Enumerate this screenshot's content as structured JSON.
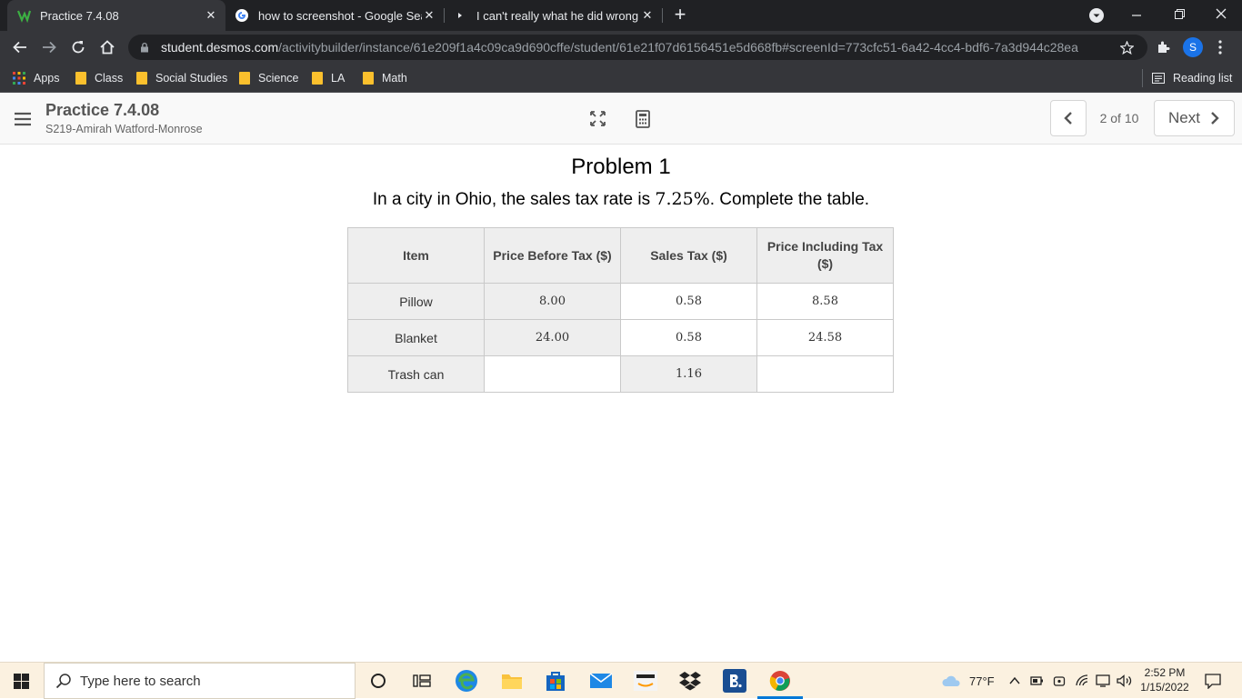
{
  "browser": {
    "tabs": [
      {
        "title": "Practice 7.4.08",
        "active": true
      },
      {
        "title": "how to screenshot - Google Sear",
        "active": false
      },
      {
        "title": "I can't really what he did wrong (",
        "active": false
      }
    ],
    "close_glyph": "✕",
    "new_tab_glyph": "+",
    "url_host": "student.desmos.com",
    "url_path": "/activitybuilder/instance/61e209f1a4c09ca9d690cffe/student/61e21f07d6156451e5d668fb#screenId=773cfc51-6a42-4cc4-bdf6-7a3d944c28ea",
    "profile_initial": "S",
    "bookmarks": {
      "apps_label": "Apps",
      "items": [
        "Class",
        "Social Studies",
        "Science",
        "LA",
        "Math"
      ],
      "reading_list": "Reading list"
    }
  },
  "app": {
    "title": "Practice 7.4.08",
    "student": "S219-Amirah Watford-Monrose",
    "page_indicator": "2 of 10",
    "next_label": "Next"
  },
  "problem": {
    "title": "Problem 1",
    "text_before": "In a city in Ohio, the sales tax rate is ",
    "rate": "7.25%",
    "text_after": ". Complete the table.",
    "table": {
      "headers": [
        "Item",
        "Price Before Tax ($)",
        "Sales Tax ($)",
        "Price Including Tax ($)"
      ],
      "rows": [
        {
          "item": "Pillow",
          "before": "8.00",
          "tax": "0.58",
          "including": "8.58"
        },
        {
          "item": "Blanket",
          "before": "24.00",
          "tax": "0.58",
          "including": "24.58"
        },
        {
          "item": "Trash can",
          "before": "",
          "tax": "1.16",
          "including": ""
        }
      ]
    }
  },
  "taskbar": {
    "search_placeholder": "Type here to search",
    "weather": "77°F",
    "time": "2:52 PM",
    "date": "1/15/2022"
  },
  "colors": {
    "chrome_dark": "#202124",
    "chrome_toolbar": "#35363a",
    "desmos_green": "#2f9e44",
    "taskbar": "#fbf1e0"
  }
}
